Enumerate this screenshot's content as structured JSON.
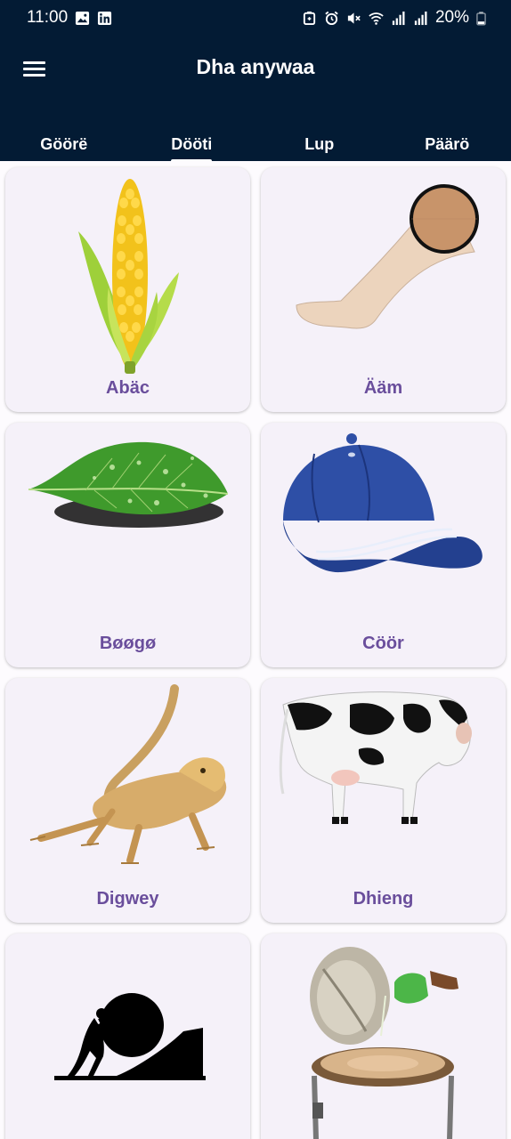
{
  "status": {
    "time": "11:00",
    "battery": "20%"
  },
  "app": {
    "title": "Dha anywaa"
  },
  "tabs": [
    {
      "label": "Göörë",
      "active": false
    },
    {
      "label": "Dööti",
      "active": true
    },
    {
      "label": "Lup",
      "active": false
    },
    {
      "label": "Päärö",
      "active": false
    }
  ],
  "cards": [
    {
      "label": "Abäc",
      "image": "corn"
    },
    {
      "label": "Ääm",
      "image": "leg-knee"
    },
    {
      "label": "Bøøgø",
      "image": "leaf"
    },
    {
      "label": "Cöör",
      "image": "cap"
    },
    {
      "label": "Digwey",
      "image": "lizard"
    },
    {
      "label": "Dhieng",
      "image": "cow"
    },
    {
      "label": "",
      "image": "boulder-push"
    },
    {
      "label": "",
      "image": "griddle"
    }
  ],
  "colors": {
    "header_bg": "#031b34",
    "card_bg": "#f5f1f9",
    "label": "#6a4e9c"
  }
}
